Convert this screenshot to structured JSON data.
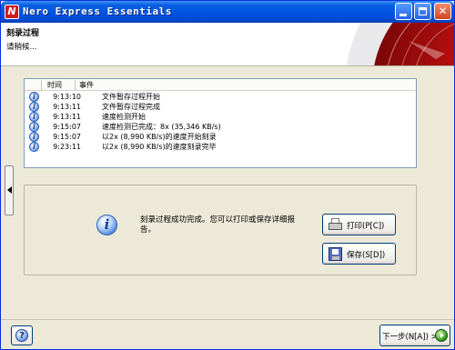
{
  "window": {
    "title": "Nero Express Essentials",
    "app_icon_glyph": "N"
  },
  "header": {
    "title": "刻录过程",
    "subtitle": "请稍候..."
  },
  "log": {
    "columns": [
      "时间",
      "事件"
    ],
    "rows": [
      {
        "icon": "info-icon",
        "time": "9:13:10",
        "event": "文件暂存过程开始"
      },
      {
        "icon": "info-icon",
        "time": "9:13:11",
        "event": "文件暂存过程完成"
      },
      {
        "icon": "info-icon",
        "time": "9:13:11",
        "event": "速度检测开始"
      },
      {
        "icon": "info-icon",
        "time": "9:15:07",
        "event": "速度检测已完成：8x (35,346 KB/s)"
      },
      {
        "icon": "info-icon",
        "time": "9:15:07",
        "event": "以2x (8,990 KB/s)的速度开始刻录"
      },
      {
        "icon": "info-icon",
        "time": "9:23:11",
        "event": "以2x (8,990 KB/s)的速度刻录完毕"
      }
    ]
  },
  "result": {
    "message": "刻录过程成功完成。您可以打印或保存详细报告。",
    "print_label": "打印(P[C])",
    "save_label": "保存(S[D])"
  },
  "footer": {
    "help_glyph": "?",
    "next_label": "下一步(N[A]) >"
  },
  "colors": {
    "titlebar": "#0054e3",
    "window_bg": "#ece9d8",
    "accent_red": "#c41212"
  }
}
